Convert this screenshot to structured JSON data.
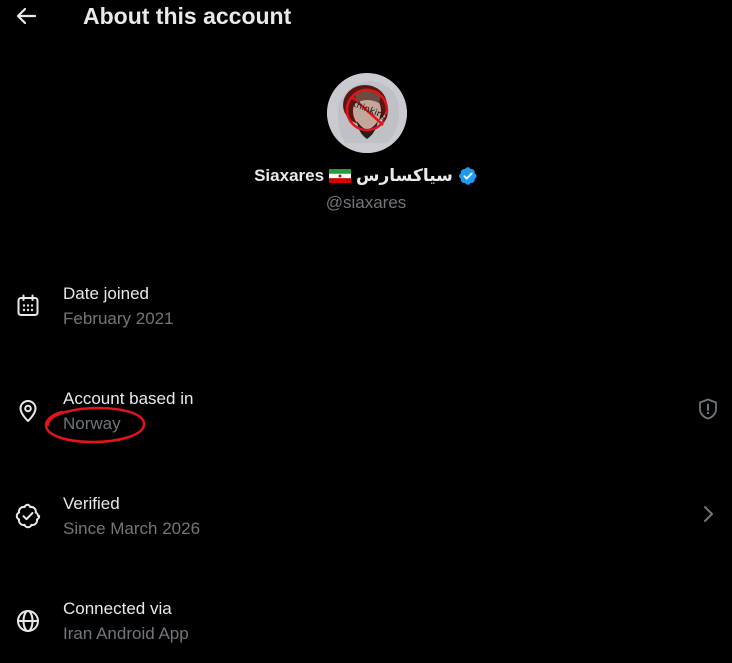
{
  "header": {
    "title": "About this account",
    "back_icon": "arrow-left-icon"
  },
  "profile": {
    "display_name": "Siaxares",
    "display_name_fa": "سیاکسارس",
    "username": "@siaxares",
    "avatar_text": "thinking",
    "verified": true,
    "verified_color": "#1d9bf0"
  },
  "rows": [
    {
      "title": "Date joined",
      "value": "February 2021",
      "icon": "calendar-icon"
    },
    {
      "title": "Account based in",
      "value": "Norway",
      "icon": "location-pin-icon",
      "right_icon": "shield-alert-icon"
    },
    {
      "title": "Verified",
      "value": "Since March 2026",
      "icon": "verified-check-icon",
      "right_icon": "chevron-right-icon"
    },
    {
      "title": "Connected via",
      "value": "Iran Android App",
      "icon": "globe-icon"
    }
  ],
  "colors": {
    "background": "#000000",
    "primary_text": "#e7e9ea",
    "secondary_text": "#71767b",
    "annotation": "#e0141b"
  }
}
